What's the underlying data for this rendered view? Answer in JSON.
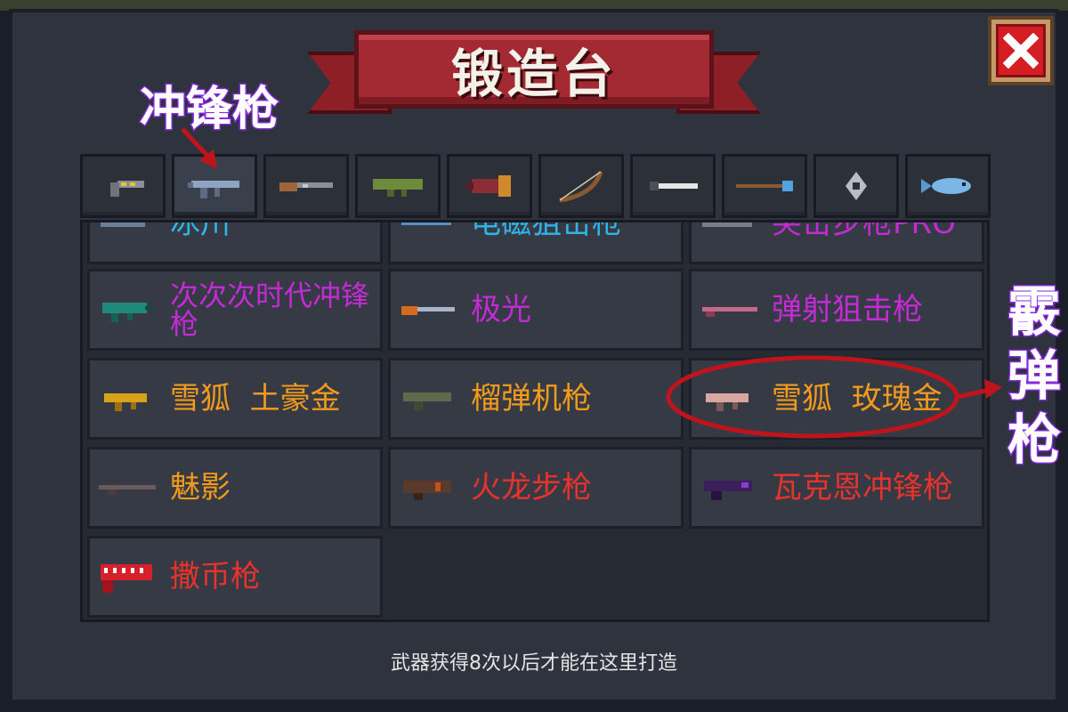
{
  "title": "锻造台",
  "annotations": {
    "category_label": "冲锋枪",
    "shotgun_label": [
      "霰",
      "弹",
      "枪"
    ]
  },
  "tabs": [
    {
      "icon": "pistol-icon",
      "active": false
    },
    {
      "icon": "smg-icon",
      "active": true
    },
    {
      "icon": "rifle-icon",
      "active": false
    },
    {
      "icon": "launcher-icon",
      "active": false
    },
    {
      "icon": "cannon-icon",
      "active": false
    },
    {
      "icon": "bow-icon",
      "active": false
    },
    {
      "icon": "sword-icon",
      "active": false
    },
    {
      "icon": "staff-icon",
      "active": false
    },
    {
      "icon": "shuriken-icon",
      "active": false
    },
    {
      "icon": "fish-icon",
      "active": false
    }
  ],
  "weapons": [
    {
      "name": "冰川",
      "color": "#2fb4e8",
      "cls": "c-blue"
    },
    {
      "name": "电磁狙击枪",
      "color": "#2fb4e8",
      "cls": "c-blue"
    },
    {
      "name": "突击步枪PRO",
      "color": "#c42bd6",
      "cls": "c-purple"
    },
    {
      "name": "次次次时代冲锋枪",
      "color": "#c42bd6",
      "cls": "c-purple"
    },
    {
      "name": "极光",
      "color": "#c42bd6",
      "cls": "c-purple"
    },
    {
      "name": "弹射狙击枪",
      "color": "#c42bd6",
      "cls": "c-purple"
    },
    {
      "name": "雪狐  土豪金",
      "color": "#f29a1c",
      "cls": "c-orange"
    },
    {
      "name": "榴弹机枪",
      "color": "#f29a1c",
      "cls": "c-orange"
    },
    {
      "name": "雪狐  玫瑰金",
      "color": "#f29a1c",
      "cls": "c-orange"
    },
    {
      "name": "魅影",
      "color": "#f29a1c",
      "cls": "c-orange"
    },
    {
      "name": "火龙步枪",
      "color": "#e8322c",
      "cls": "c-red"
    },
    {
      "name": "瓦克恩冲锋枪",
      "color": "#e8322c",
      "cls": "c-red"
    },
    {
      "name": "撒币枪",
      "color": "#e8322c",
      "cls": "c-red"
    }
  ],
  "hint": "武器获得8次以后才能在这里打造",
  "colors": {
    "annotation_red": "#c0141c",
    "annotation_purple": "#8a2be2"
  }
}
